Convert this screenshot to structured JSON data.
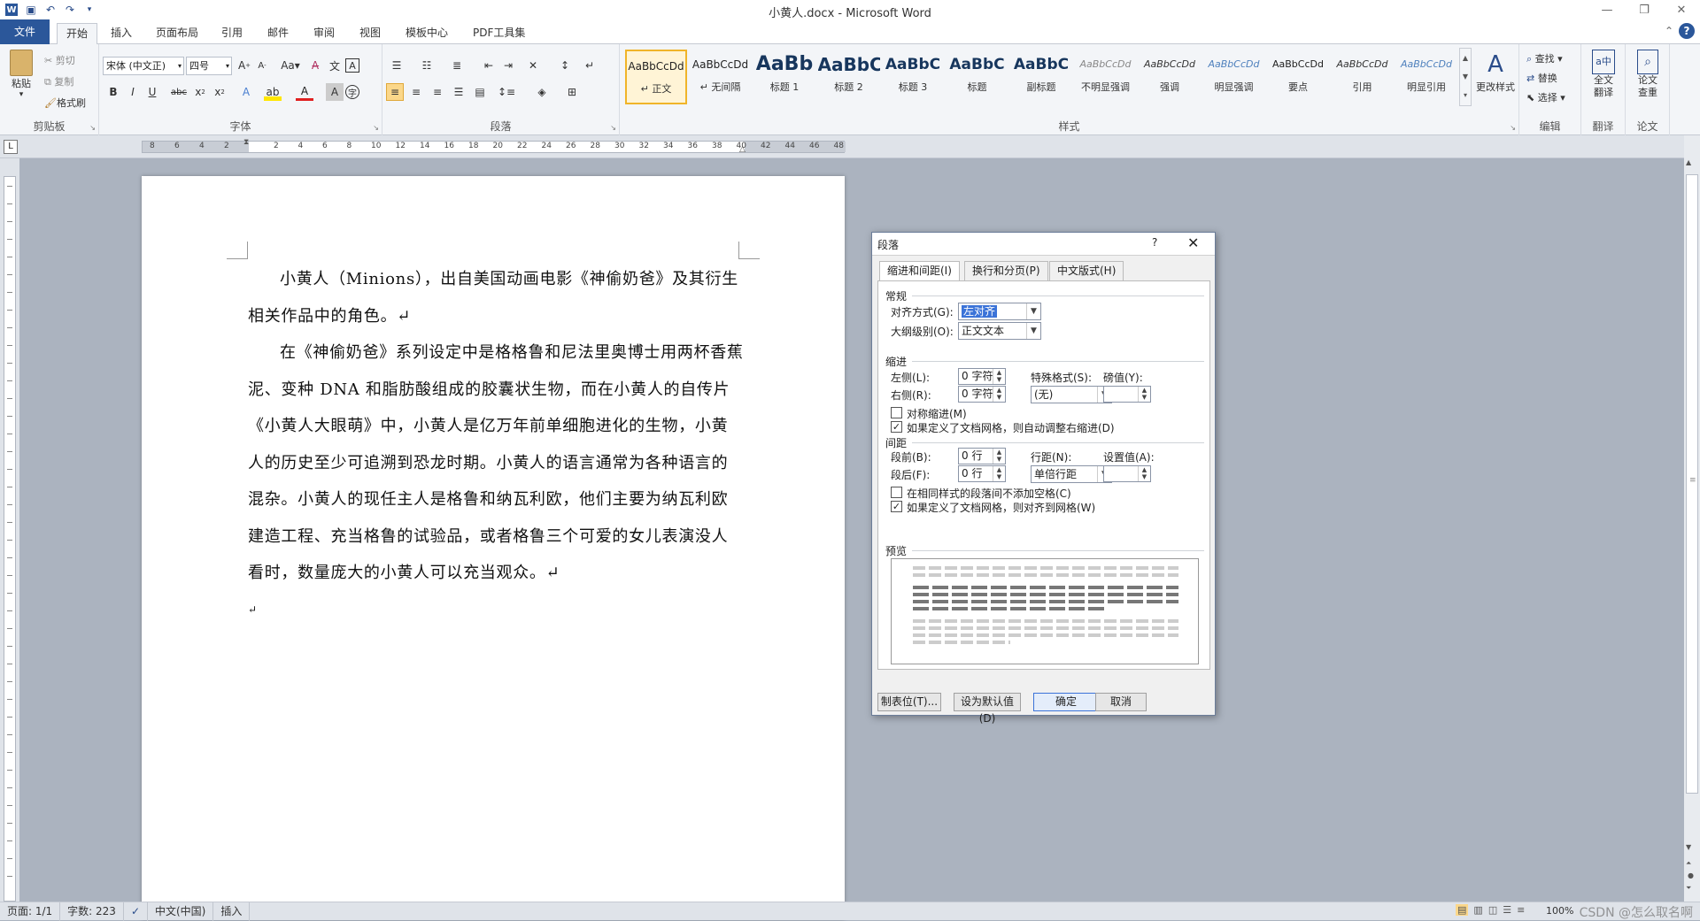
{
  "window": {
    "title": "小黄人.docx - Microsoft Word"
  },
  "tabs": [
    "文件",
    "开始",
    "插入",
    "页面布局",
    "引用",
    "邮件",
    "审阅",
    "视图",
    "模板中心",
    "PDF工具集"
  ],
  "clipboard": {
    "paste": "粘贴",
    "cut": "剪切",
    "copy": "复制",
    "format_painter": "格式刷",
    "label": "剪贴板"
  },
  "font": {
    "name": "宋体 (中文正)",
    "size": "四号",
    "label": "字体"
  },
  "paragraph": {
    "label": "段落"
  },
  "styles": {
    "items": [
      {
        "preview": "AaBbCcDd",
        "name": "↵ 正文"
      },
      {
        "preview": "AaBbCcDd",
        "name": "↵ 无间隔"
      },
      {
        "preview": "AaBb",
        "name": "标题 1"
      },
      {
        "preview": "AaBbC",
        "name": "标题 2"
      },
      {
        "preview": "AaBbC",
        "name": "标题 3"
      },
      {
        "preview": "AaBbC",
        "name": "标题"
      },
      {
        "preview": "AaBbC",
        "name": "副标题"
      },
      {
        "preview": "AaBbCcDd",
        "name": "不明显强调"
      },
      {
        "preview": "AaBbCcDd",
        "name": "强调"
      },
      {
        "preview": "AaBbCcDd",
        "name": "明显强调"
      },
      {
        "preview": "AaBbCcDd",
        "name": "要点"
      },
      {
        "preview": "AaBbCcDd",
        "name": "引用"
      },
      {
        "preview": "AaBbCcDd",
        "name": "明显引用"
      }
    ],
    "change": "更改样式",
    "label": "样式"
  },
  "editing": {
    "find": "查找",
    "replace": "替换",
    "select": "选择",
    "label": "编辑"
  },
  "translate": {
    "btn": "全文翻译",
    "label": "翻译"
  },
  "paper": {
    "btn": "论文查重",
    "label": "论文"
  },
  "ruler": {
    "ticks": [
      "8",
      "6",
      "4",
      "2",
      "2",
      "4",
      "6",
      "8",
      "10",
      "12",
      "14",
      "16",
      "18",
      "20",
      "22",
      "24",
      "26",
      "28",
      "30",
      "32",
      "34",
      "36",
      "38",
      "40",
      "42",
      "44",
      "46",
      "48"
    ]
  },
  "document": {
    "p1": "小黄人（Minions），出自美国动画电影《神偷奶爸》及其衍生相关作品中的角色。↵",
    "p2": "在《神偷奶爸》系列设定中是格格鲁和尼法里奥博士用两杯香蕉泥、变种 DNA 和脂肪酸组成的胶囊状生物，而在小黄人的自传片《小黄人大眼萌》中，小黄人是亿万年前单细胞进化的生物，小黄人的历史至少可追溯到恐龙时期。小黄人的语言通常为各种语言的混杂。小黄人的现任主人是格鲁和纳瓦利欧，他们主要为纳瓦利欧建造工程、充当格鲁的试验品，或者格鲁三个可爱的女儿表演没人看时，数量庞大的小黄人可以充当观众。↵",
    "p3": "↵"
  },
  "dialog": {
    "title": "段落",
    "help": "?",
    "tabs": [
      "缩进和间距(I)",
      "换行和分页(P)",
      "中文版式(H)"
    ],
    "general": "常规",
    "align_label": "对齐方式(G):",
    "align_value": "左对齐",
    "outline_label": "大纲级别(O):",
    "outline_value": "正文文本",
    "indent": "缩进",
    "left_label": "左侧(L):",
    "left_value": "0 字符",
    "right_label": "右侧(R):",
    "right_value": "0 字符",
    "special_label": "特殊格式(S):",
    "special_value": "(无)",
    "by_label": "磅值(Y):",
    "mirror": "对称缩进(M)",
    "auto_indent": "如果定义了文档网格，则自动调整右缩进(D)",
    "spacing": "间距",
    "before_label": "段前(B):",
    "before_value": "0 行",
    "after_label": "段后(F):",
    "after_value": "0 行",
    "line_label": "行距(N):",
    "line_value": "单倍行距",
    "at_label": "设置值(A):",
    "no_space": "在相同样式的段落间不添加空格(C)",
    "snap_grid": "如果定义了文档网格，则对齐到网格(W)",
    "preview": "预览",
    "tabs_btn": "制表位(T)...",
    "default_btn": "设为默认值(D)",
    "ok": "确定",
    "cancel": "取消"
  },
  "status": {
    "page": "页面: 1/1",
    "words": "字数: 223",
    "lang": "中文(中国)",
    "insert": "插入",
    "zoom": "100%",
    "watermark": "CSDN @怎么取名啊"
  }
}
